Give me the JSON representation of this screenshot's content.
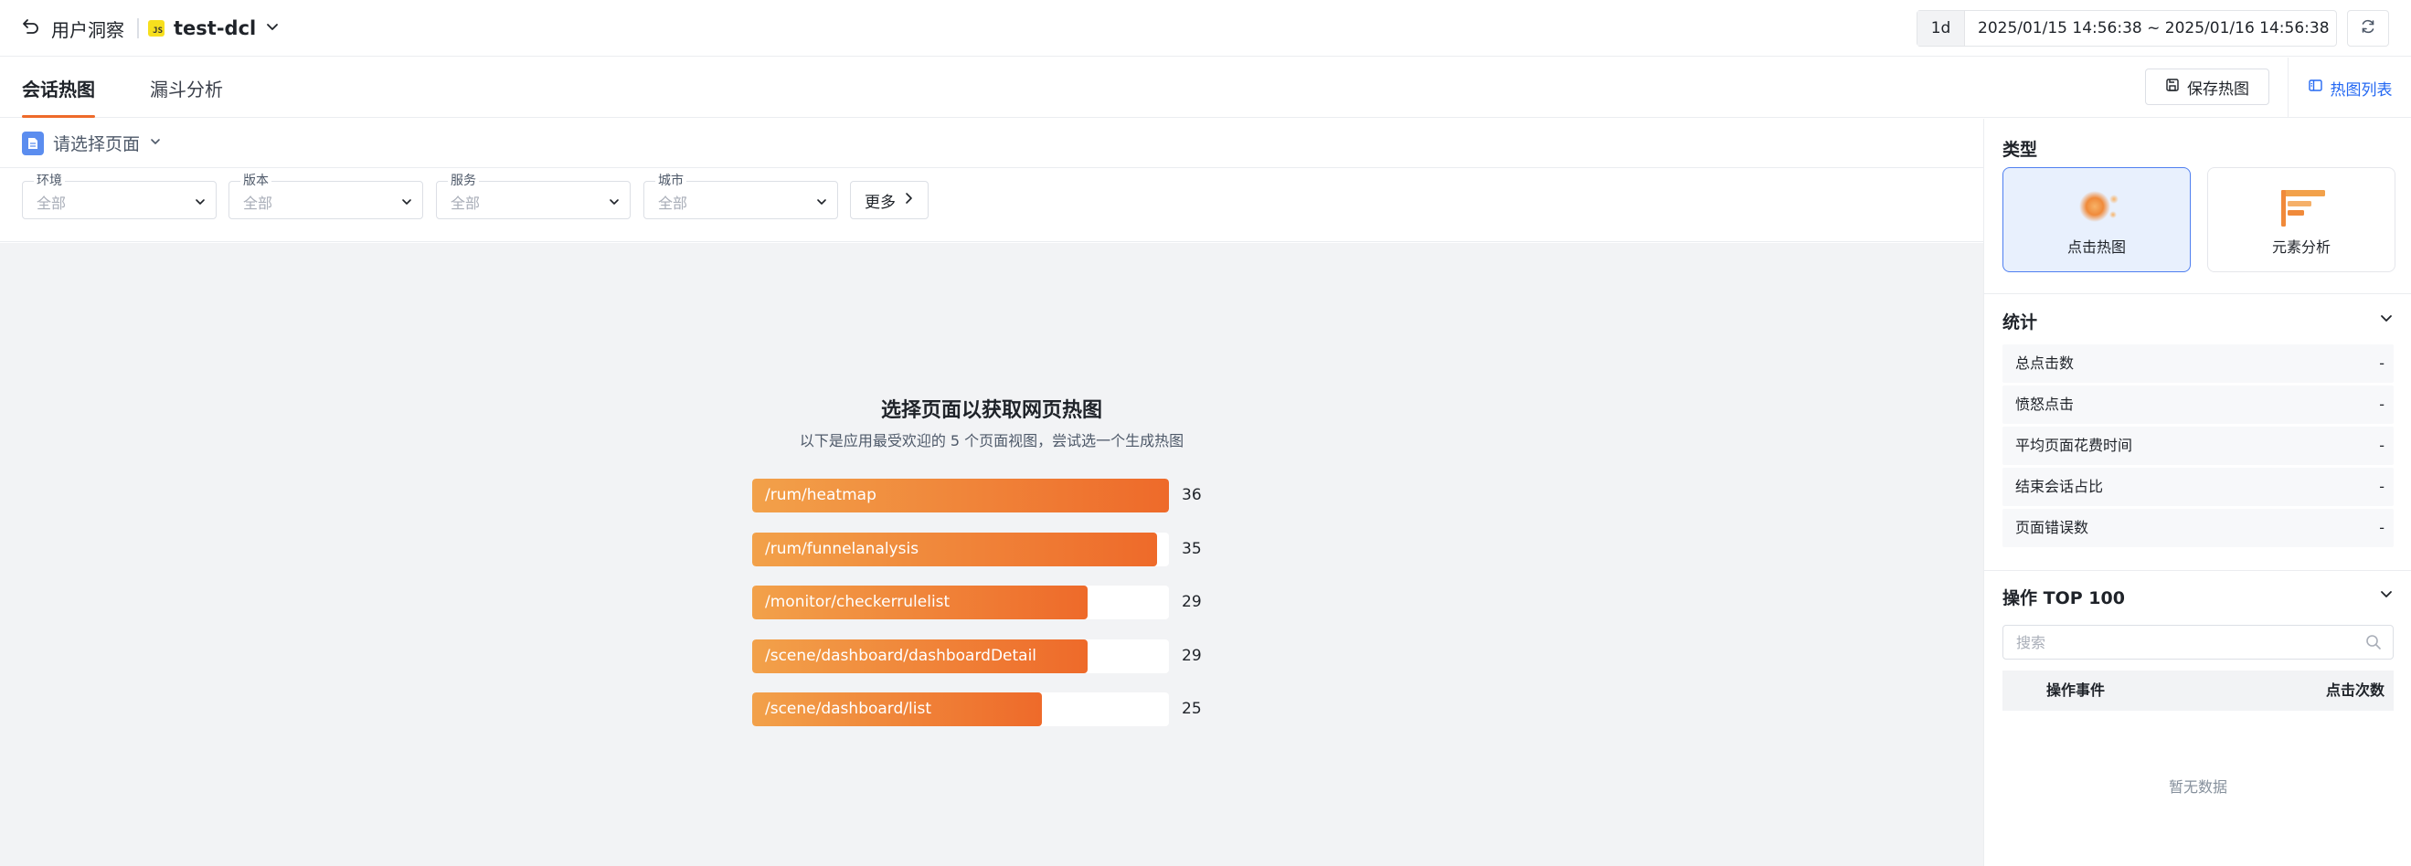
{
  "header": {
    "back_label": "用户洞察",
    "app_icon": "js-icon",
    "app_name": "test-dcl",
    "time_unit": "1d",
    "time_range": "2025/01/15 14:56:38 ~ 2025/01/16 14:56:38"
  },
  "tabs": [
    {
      "label": "会话热图",
      "active": true
    },
    {
      "label": "漏斗分析",
      "active": false
    }
  ],
  "toolbar": {
    "save_label": "保存热图",
    "list_label": "热图列表"
  },
  "page_select": {
    "placeholder": "请选择页面"
  },
  "filters": [
    {
      "label": "环境",
      "value": "全部"
    },
    {
      "label": "版本",
      "value": "全部"
    },
    {
      "label": "服务",
      "value": "全部"
    },
    {
      "label": "城市",
      "value": "全部"
    }
  ],
  "more_label": "更多",
  "main": {
    "title": "选择页面以获取网页热图",
    "subtitle": "以下是应用最受欢迎的 5 个页面视图，尝试选一个生成热图"
  },
  "chart_data": {
    "type": "bar",
    "orientation": "horizontal",
    "categories": [
      "/rum/heatmap",
      "/rum/funnelanalysis",
      "/monitor/checkerrulelist",
      "/scene/dashboard/dashboardDetail",
      "/scene/dashboard/list"
    ],
    "values": [
      36,
      35,
      29,
      29,
      25
    ],
    "colors": {
      "start": "#f2a14a",
      "end": "#ee6a2a"
    }
  },
  "right_panel": {
    "type_title": "类型",
    "types": [
      {
        "label": "点击热图",
        "icon": "click-heatmap-icon",
        "active": true
      },
      {
        "label": "元素分析",
        "icon": "element-analysis-icon",
        "active": false
      }
    ],
    "stats_title": "统计",
    "stats": [
      {
        "label": "总点击数",
        "value": "-"
      },
      {
        "label": "愤怒点击",
        "value": "-"
      },
      {
        "label": "平均页面花费时间",
        "value": "-"
      },
      {
        "label": "结束会话占比",
        "value": "-"
      },
      {
        "label": "页面错误数",
        "value": "-"
      }
    ],
    "ops_title": "操作 TOP 100",
    "search_placeholder": "搜索",
    "table_headers": {
      "event": "操作事件",
      "clicks": "点击次数"
    },
    "empty_text": "暂无数据"
  }
}
